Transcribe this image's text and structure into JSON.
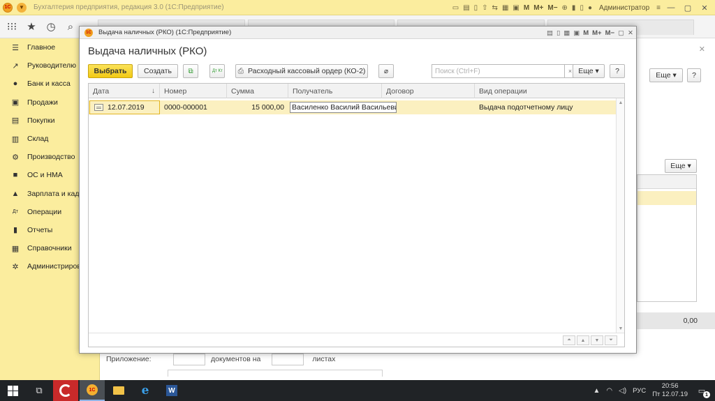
{
  "app": {
    "title": "Бухгалтерия предприятия, редакция 3.0  (1С:Предприятие)",
    "user": "Администратор",
    "logo_text": "1С",
    "m_buttons": [
      "M",
      "M+",
      "M−"
    ]
  },
  "sidebar": {
    "items": [
      {
        "label": "Главное",
        "icon": "☰"
      },
      {
        "label": "Руководителю",
        "icon": "↗"
      },
      {
        "label": "Банк и касса",
        "icon": "●"
      },
      {
        "label": "Продажи",
        "icon": "▣"
      },
      {
        "label": "Покупки",
        "icon": "▤"
      },
      {
        "label": "Склад",
        "icon": "▥"
      },
      {
        "label": "Производство",
        "icon": "⚙"
      },
      {
        "label": "ОС и НМА",
        "icon": "■"
      },
      {
        "label": "Зарплата и кадры",
        "icon": "▲"
      },
      {
        "label": "Операции",
        "icon": "Дт"
      },
      {
        "label": "Отчеты",
        "icon": "▮"
      },
      {
        "label": "Справочники",
        "icon": "▦"
      },
      {
        "label": "Администрирование",
        "icon": "✲"
      }
    ]
  },
  "background": {
    "more_label": "Еще",
    "help_label": "?",
    "sum_value": "0,00",
    "footer_attachment_label": "Приложение:",
    "footer_docs_label": "документов на",
    "footer_sheets_label": "листах"
  },
  "modal": {
    "window_caption": "Выдача наличных (РКО)  (1С:Предприятие)",
    "form_title": "Выдача наличных (РКО)",
    "toolbar": {
      "select_label": "Выбрать",
      "create_label": "Создать",
      "dtkt_label": "Дт Кт",
      "print_label": "Расходный кассовый ордер (КО-2)",
      "search_placeholder": "Поиск (Ctrl+F)",
      "clear_label": "×",
      "more_label": "Еще",
      "help_label": "?"
    },
    "columns": [
      "Дата",
      "Номер",
      "Сумма",
      "Получатель",
      "Договор",
      "Вид операции"
    ],
    "rows": [
      {
        "date": "12.07.2019",
        "number": "0000-000001",
        "amount": "15 000,00",
        "recipient": "Василенко Василий Васильевич",
        "contract": "",
        "operation": "Выдача подотчетному лицу"
      }
    ]
  },
  "taskbar": {
    "language": "РУС",
    "time": "20:56",
    "date": "Пт 12.07.19",
    "notifications": "1"
  },
  "colors": {
    "accent_yellow": "#fbed9e",
    "primary_button": "#f2c914",
    "selected_row": "#fbf0c0"
  }
}
